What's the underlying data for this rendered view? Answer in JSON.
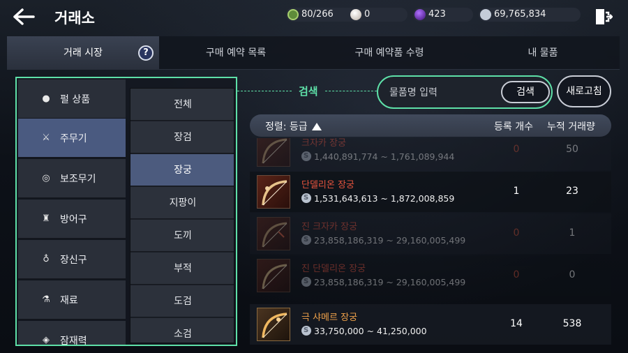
{
  "header": {
    "title": "거래소",
    "currencies": [
      {
        "icon": "green-gem-icon",
        "value": "80/266",
        "color": "#6fa84a"
      },
      {
        "icon": "pearl-icon",
        "value": "0",
        "color": "#d8d0c8"
      },
      {
        "icon": "purple-orb-icon",
        "value": "423",
        "color": "#6a2cc0"
      },
      {
        "icon": "silver-coin-icon",
        "value": "69,765,834",
        "color": "#b9c2cf"
      }
    ]
  },
  "tabs": [
    {
      "label": "거래 시장",
      "active": true,
      "help": "?"
    },
    {
      "label": "구매 예약 목록",
      "active": false
    },
    {
      "label": "구매 예약품 수령",
      "active": false
    },
    {
      "label": "내 물품",
      "active": false
    }
  ],
  "categories": [
    {
      "label": "펄 상품",
      "icon": "pearl-icon",
      "glyph": "●"
    },
    {
      "label": "주무기",
      "icon": "crossed-swords-icon",
      "glyph": "⚔",
      "active": true
    },
    {
      "label": "보조무기",
      "icon": "shield-ring-icon",
      "glyph": "◎"
    },
    {
      "label": "방어구",
      "icon": "armor-icon",
      "glyph": "♜"
    },
    {
      "label": "장신구",
      "icon": "ring-icon",
      "glyph": "♁"
    },
    {
      "label": "재료",
      "icon": "flask-icon",
      "glyph": "⚗"
    },
    {
      "label": "잠재력",
      "icon": "diamond-icon",
      "glyph": "◈"
    }
  ],
  "subcategories": [
    {
      "label": "전체"
    },
    {
      "label": "장검"
    },
    {
      "label": "장궁",
      "active": true
    },
    {
      "label": "지팡이"
    },
    {
      "label": "도끼"
    },
    {
      "label": "부적"
    },
    {
      "label": "도검"
    },
    {
      "label": "소검"
    }
  ],
  "search": {
    "label": "검색",
    "placeholder": "물품명 입력",
    "button": "검색",
    "refresh": "새로고침"
  },
  "table": {
    "sort_label": "정렬: 등급",
    "col_count": "등록 개수",
    "col_volume": "누적 거래량"
  },
  "items": [
    {
      "name": "크자카 장궁",
      "price": "1,440,891,774 ~ 1,761,089,944",
      "count": "0",
      "volume": "50",
      "dim": true,
      "grade": "red"
    },
    {
      "name": "단델리온 장궁",
      "price": "1,531,643,613 ~ 1,872,008,859",
      "count": "1",
      "volume": "23",
      "dim": false,
      "grade": "red"
    },
    {
      "name": "진 크자카 장궁",
      "price": "23,858,186,319 ~ 29,160,005,499",
      "count": "0",
      "volume": "1",
      "dim": true,
      "grade": "red"
    },
    {
      "name": "진 단델리온 장궁",
      "price": "23,858,186,319 ~ 29,160,005,499",
      "count": "0",
      "volume": "0",
      "dim": true,
      "grade": "red"
    },
    {
      "name": "극 샤메르 장궁",
      "price": "33,750,000 ~ 41,250,000",
      "count": "14",
      "volume": "538",
      "dim": false,
      "grade": "gold"
    }
  ]
}
